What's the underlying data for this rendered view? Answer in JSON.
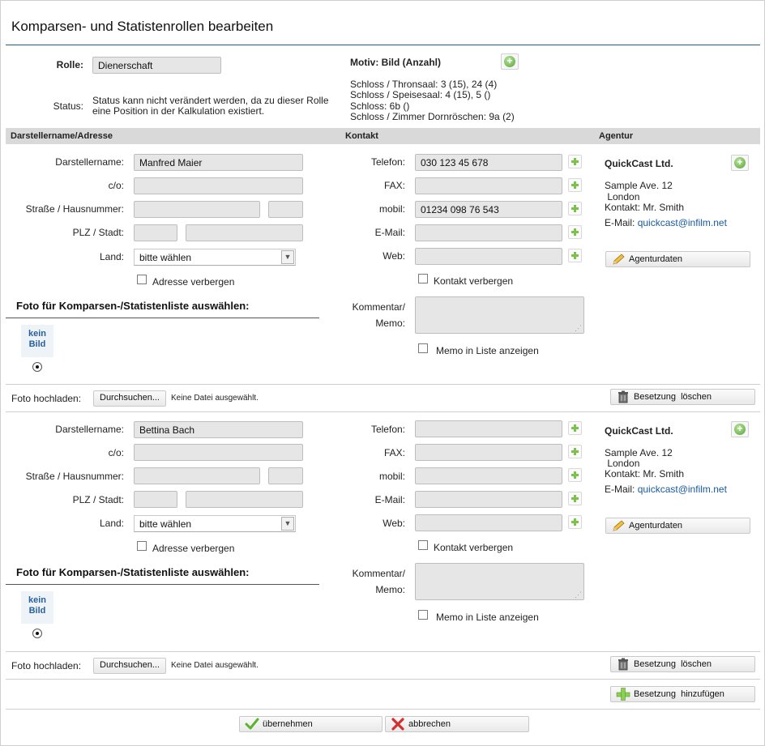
{
  "page": {
    "title": "Komparsen- und Statistenrollen bearbeiten"
  },
  "role": {
    "label": "Rolle:",
    "value": "Dienerschaft",
    "status_label": "Status:",
    "status_text_1": "Status kann nicht verändert werden, da zu dieser Rolle",
    "status_text_2": "eine Position in der Kalkulation existiert."
  },
  "motiv": {
    "label": "Motiv: Bild (Anzahl)",
    "lines": [
      "Schloss / Thronsaal: 3 (15), 24 (4)",
      "Schloss / Speisesaal: 4 (15), 5 ()",
      "Schloss: 6b ()",
      "Schloss / Zimmer Dornröschen: 9a (2)"
    ]
  },
  "section_headers": {
    "name_address": "Darstellername/Adresse",
    "contact": "Kontakt",
    "agency": "Agentur"
  },
  "labels": {
    "darstellername": "Darstellername:",
    "co": "c/o:",
    "strasse": "Straße / Hausnummer:",
    "plz": "PLZ / Stadt:",
    "land": "Land:",
    "adresse_verbergen": "Adresse verbergen",
    "photo_heading": "Foto für Komparsen-/Statistenliste auswählen:",
    "no_image_1": "kein",
    "no_image_2": "Bild",
    "telefon": "Telefon:",
    "fax": "FAX:",
    "mobil": "mobil:",
    "email": "E-Mail:",
    "web": "Web:",
    "kontakt_verbergen": "Kontakt verbergen",
    "kommentar_1": "Kommentar/",
    "kommentar_2": "Memo:",
    "memo_anzeigen": "Memo in Liste anzeigen",
    "foto_hochladen": "Foto hochladen:",
    "durchsuchen": "Durchsuchen...",
    "keine_datei": "Keine Datei ausgewählt.",
    "agenturdaten": "Agenturdaten",
    "besetzung_loeschen": "Besetzung  löschen",
    "email_agency_label": "E-Mail:"
  },
  "castings": [
    {
      "name": "Manfred Maier",
      "co": "",
      "street": "",
      "house_no": "",
      "zip": "",
      "city": "",
      "country": "bitte wählen",
      "phone": "030 123 45 678",
      "fax": "",
      "mobile": "01234 098 76 543",
      "email": "",
      "web": "",
      "agency": {
        "name": "QuickCast Ltd.",
        "street": "Sample Ave. 12",
        "city": " London",
        "contact": "Kontakt: Mr. Smith",
        "email": "quickcast@infilm.net"
      }
    },
    {
      "name": "Bettina Bach",
      "co": "",
      "street": "",
      "house_no": "",
      "zip": "",
      "city": "",
      "country": "bitte wählen",
      "phone": "",
      "fax": "",
      "mobile": "",
      "email": "",
      "web": "",
      "agency": {
        "name": "QuickCast Ltd.",
        "street": "Sample Ave. 12",
        "city": " London",
        "contact": "Kontakt: Mr. Smith",
        "email": "quickcast@infilm.net"
      }
    }
  ],
  "footer": {
    "add_casting": "Besetzung  hinzufügen",
    "apply": "übernehmen",
    "cancel": "abbrechen"
  },
  "colors": {
    "title_rule": "#1d5d8a",
    "section_bar": "#d9d9d9",
    "link": "#1a5aa0",
    "plus_green": "#7cc24a",
    "cancel_red": "#d43030"
  },
  "icons": {
    "add": "plus-icon",
    "add_circle": "plus-circle-icon",
    "trash": "trash-icon",
    "pencil": "pencil-icon",
    "check": "check-icon",
    "cancel": "x-icon"
  }
}
